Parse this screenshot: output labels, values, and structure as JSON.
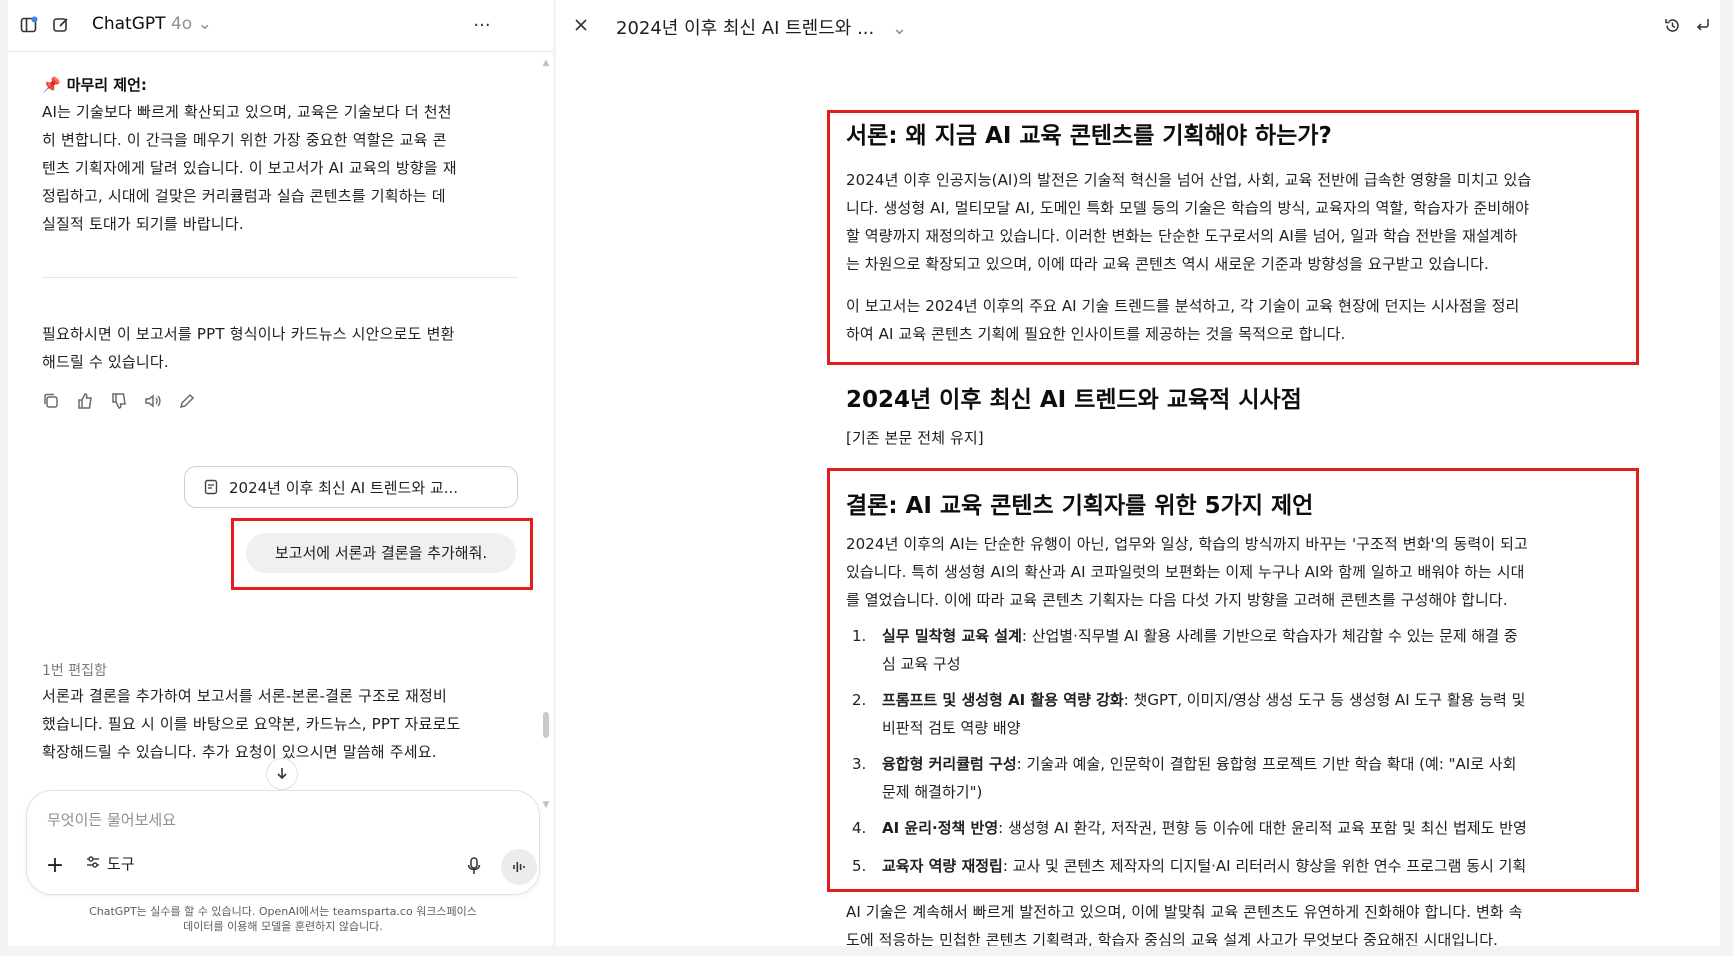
{
  "left_panel": {
    "header": {
      "app_name": "ChatGPT",
      "model_version": "4o"
    },
    "closing_title": "마무리 제언:",
    "closing_lines": [
      "AI는 기술보다 빠르게 확산되고 있으며, 교육은 기술보다 더 천천",
      "히 변합니다. 이 간극을 메우기 위한 가장 중요한 역할은 교육 콘",
      "텐츠 기획자에게 달려 있습니다. 이 보고서가 AI 교육의 방향을 재",
      "정립하고, 시대에 걸맞은 커리큘럼과 실습 콘텐츠를 기획하는 데",
      "실질적 토대가 되기를 바랍니다."
    ],
    "followup_lines": [
      "필요하시면 이 보고서를 PPT 형식이나 카드뉴스 시안으로도 변환",
      "해드릴 수 있습니다."
    ],
    "doc_chip_label": "2024년 이후 최신 AI 트렌드와 교...",
    "user_message": "보고서에 서론과 결론을 추가해줘.",
    "edit_label": "1번 편집함",
    "reply_lines": [
      "서론과 결론을 추가하여 보고서를 서론-본론-결론 구조로 재정비",
      "했습니다. 필요 시 이를 바탕으로 요약본, 카드뉴스, PPT 자료로도",
      "확장해드릴 수 있습니다. 추가 요청이 있으시면 말씀해 주세요."
    ],
    "composer": {
      "placeholder": "무엇이든 물어보세요",
      "tools_label": "도구"
    },
    "disclaimer_lines": [
      "ChatGPT는 실수를 할 수 있습니다. OpenAI에서는 teamsparta.co 워크스페이스",
      "데이터를 이용해 모델을 훈련하지 않습니다."
    ],
    "icons": [
      "sidebar-icon",
      "new-chat-icon",
      "more-icon",
      "copy-icon",
      "thumbs-up-icon",
      "thumbs-down-icon",
      "read-aloud-icon",
      "edit-icon",
      "document-icon",
      "arrow-down-icon",
      "plus-icon",
      "tools-icon",
      "mic-icon",
      "voice-mode-icon"
    ]
  },
  "right_panel": {
    "title": "2024년 이후 최신 AI 트렌드와 ...",
    "intro": {
      "heading": "서론: 왜 지금 AI 교육 콘텐츠를 기획해야 하는가?",
      "para1_lines": [
        "2024년 이후 인공지능(AI)의 발전은 기술적 혁신을 넘어 산업, 사회, 교육 전반에 급속한 영향을 미치고 있습",
        "니다. 생성형 AI, 멀티모달 AI, 도메인 특화 모델 등의 기술은 학습의 방식, 교육자의 역할, 학습자가 준비해야",
        "할 역량까지 재정의하고 있습니다. 이러한 변화는 단순한 도구로서의 AI를 넘어, 일과 학습 전반을 재설계하",
        "는 차원으로 확장되고 있으며, 이에 따라 교육 콘텐츠 역시 새로운 기준과 방향성을 요구받고 있습니다."
      ],
      "para2_lines": [
        "이 보고서는 2024년 이후의 주요 AI 기술 트렌드를 분석하고, 각 기술이 교육 현장에 던지는 시사점을 정리",
        "하여 AI 교육 콘텐츠 기획에 필요한 인사이트를 제공하는 것을 목적으로 합니다."
      ]
    },
    "body": {
      "heading": "2024년 이후 최신 AI 트렌드와 교육적 시사점",
      "placeholder": "[기존 본문 전체 유지]"
    },
    "conclusion": {
      "heading": "결론: AI 교육 콘텐츠 기획자를 위한 5가지 제언",
      "para_lines": [
        "2024년 이후의 AI는 단순한 유행이 아닌, 업무와 일상, 학습의 방식까지 바꾸는 '구조적 변화'의 동력이 되고",
        "있습니다. 특히 생성형 AI의 확산과 AI 코파일럿의 보편화는 이제 누구나 AI와 함께 일하고 배워야 하는 시대",
        "를 열었습니다. 이에 따라 교육 콘텐츠 기획자는 다음 다섯 가지 방향을 고려해 콘텐츠를 구성해야 합니다."
      ],
      "items": [
        {
          "num": "1.",
          "bold": "실무 밀착형 교육 설계",
          "lines": [
            ": 산업별·직무별 AI 활용 사례를 기반으로 학습자가 체감할 수 있는 문제 해결 중",
            "심 교육 구성"
          ]
        },
        {
          "num": "2.",
          "bold": "프롬프트 및 생성형 AI 활용 역량 강화",
          "lines": [
            ": 챗GPT, 이미지/영상 생성 도구 등 생성형 AI 도구 활용 능력 및",
            "비판적 검토 역량 배양"
          ]
        },
        {
          "num": "3.",
          "bold": "융합형 커리큘럼 구성",
          "lines": [
            ": 기술과 예술, 인문학이 결합된 융합형 프로젝트 기반 학습 확대 (예: \"AI로 사회",
            "문제 해결하기\")"
          ]
        },
        {
          "num": "4.",
          "bold": "AI 윤리·정책 반영",
          "lines": [
            ": 생성형 AI 환각, 저작권, 편향 등 이슈에 대한 윤리적 교육 포함 및 최신 법제도 반영"
          ]
        },
        {
          "num": "5.",
          "bold": "교육자 역량 재정립",
          "lines": [
            ": 교사 및 콘텐츠 제작자의 디지털·AI 리터러시 향상을 위한 연수 프로그램 동시 기획"
          ]
        }
      ],
      "outro_lines": [
        "AI 기술은 계속해서 빠르게 발전하고 있으며, 이에 발맞춰 교육 콘텐츠도 유연하게 진화해야 합니다. 변화 속",
        "도에 적응하는 민첩한 콘텐츠 기획력과, 학습자 중심의 교육 설계 사고가 무엇보다 중요해진 시대입니다."
      ]
    },
    "icons": [
      "close-icon",
      "chevron-down-icon",
      "history-icon",
      "undo-icon"
    ]
  },
  "colors": {
    "highlight_box": "#e01e1e",
    "pin": "#d6336c",
    "badge_blue": "#3b82f6"
  }
}
